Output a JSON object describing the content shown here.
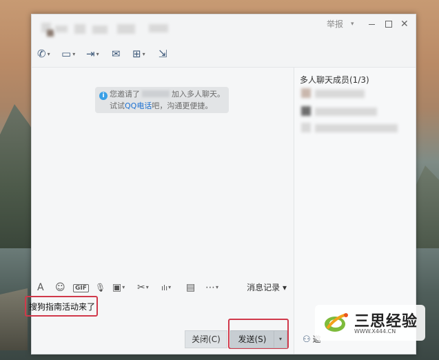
{
  "window": {
    "report_label": "举报",
    "report_caret": "▾",
    "close_glyph": "✕"
  },
  "toolbar": {
    "items": [
      {
        "icon": "phone-icon",
        "glyph": "✆"
      },
      {
        "icon": "screen-share-icon",
        "glyph": "▭"
      },
      {
        "icon": "file-transfer-icon",
        "glyph": "⇥"
      },
      {
        "icon": "mail-icon",
        "glyph": "✉"
      },
      {
        "icon": "app-add-icon",
        "glyph": "⊞"
      },
      {
        "icon": "exit-group-icon",
        "glyph": "⇲"
      }
    ],
    "caret": "▾"
  },
  "chat": {
    "system_message": {
      "line1_prefix": "您邀请了",
      "line1_suffix": "加入多人聊天。",
      "line2_prefix": "试试",
      "line2_link": "QQ电话",
      "line2_suffix": "吧，沟通更便捷。"
    }
  },
  "members": {
    "title": "多人聊天成员(1/3)"
  },
  "input_toolbar": {
    "items": [
      {
        "icon": "font-icon",
        "glyph": "A"
      },
      {
        "icon": "emoji-icon",
        "glyph": "☺"
      },
      {
        "icon": "gif-icon",
        "glyph": "GIF"
      },
      {
        "icon": "voice-icon",
        "glyph": "🎙"
      },
      {
        "icon": "image-icon",
        "glyph": "▣"
      },
      {
        "icon": "screenshot-icon",
        "glyph": "✂"
      },
      {
        "icon": "chart-icon",
        "glyph": "ılı"
      },
      {
        "icon": "red-packet-icon",
        "glyph": "▤"
      },
      {
        "icon": "more-icon",
        "glyph": "⋯"
      }
    ],
    "history_label": "消息记录 ▾"
  },
  "input": {
    "value": "搜狗指南活动来了"
  },
  "buttons": {
    "close_label": "关闭(C)",
    "send_label": "发送(S)",
    "send_caret": "▾",
    "invite_label": "邀"
  },
  "watermark": {
    "title": "三思经验",
    "url": "WWW.X444.CN"
  },
  "colors": {
    "highlight": "#d0384a",
    "link": "#1a6fd1",
    "info": "#3aa0e6"
  }
}
